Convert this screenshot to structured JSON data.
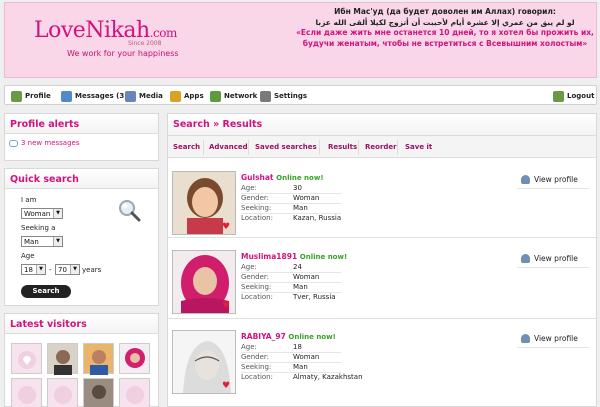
{
  "header": {
    "logo_main": "LoveNikah",
    "logo_tld": ".com",
    "since": "Since 2008",
    "tagline": "We work for your happiness",
    "quote_title": "Ибн Мас'уд (да будет доволен им Аллах) говорил:",
    "quote_arabic": "لو لم يبق من عمري إلا عشرة أيام لأحببت أن أتزوج لكيلا ألقى الله عزبا",
    "quote_ru": "«Если даже жить мне останется 10 дней, то я хотел бы прожить их, будучи женатым, чтобы не встретиться с Всевышним холостым»"
  },
  "nav": {
    "items": [
      {
        "label": "Profile",
        "icon": "profile-icon",
        "color": "#6a9a45"
      },
      {
        "label": "Messages (3)",
        "icon": "messages-icon",
        "color": "#4f8ac9"
      },
      {
        "label": "Media",
        "icon": "media-icon",
        "color": "#6a86b8"
      },
      {
        "label": "Apps",
        "icon": "apps-icon",
        "color": "#d8a321"
      },
      {
        "label": "Network",
        "icon": "network-icon",
        "color": "#5d9c3c"
      },
      {
        "label": "Settings",
        "icon": "settings-icon",
        "color": "#7a7a7a"
      }
    ],
    "logout": "Logout"
  },
  "sidebar": {
    "alerts_title": "Profile alerts",
    "alerts_link": "3 new messages",
    "quicksearch_title": "Quick search",
    "i_am_label": "I am",
    "i_am_value": "Woman",
    "seeking_label": "Seeking a",
    "seeking_value": "Man",
    "age_label": "Age",
    "age_from": "18",
    "age_dash": "-",
    "age_to": "70",
    "age_unit": "years",
    "search_button": "Search",
    "visitors_title": "Latest visitors"
  },
  "results": {
    "breadcrumb": "Search » Results",
    "tabs": [
      "Search",
      "Advanced",
      "Saved searches",
      "Results",
      "Reorder",
      "Save it"
    ],
    "field_labels": {
      "age": "Age:",
      "gender": "Gender:",
      "seeking": "Seeking:",
      "location": "Location:"
    },
    "view_label": "View profile",
    "profiles": [
      {
        "name": "Gulshat",
        "status": "Online now!",
        "age": "30",
        "gender": "Woman",
        "seeking": "Man",
        "location": "Kazan, Russia"
      },
      {
        "name": "Muslima1891",
        "status": "Online now!",
        "age": "24",
        "gender": "Woman",
        "seeking": "Man",
        "location": "Tver, Russia"
      },
      {
        "name": "RABIYA_97",
        "status": "Online now!",
        "age": "18",
        "gender": "Woman",
        "seeking": "Man",
        "location": "Almaty, Kazakhstan"
      }
    ]
  },
  "colors": {
    "brand": "#d2127e",
    "online": "#3aa02a",
    "header_bg": "#f9d6e8"
  }
}
